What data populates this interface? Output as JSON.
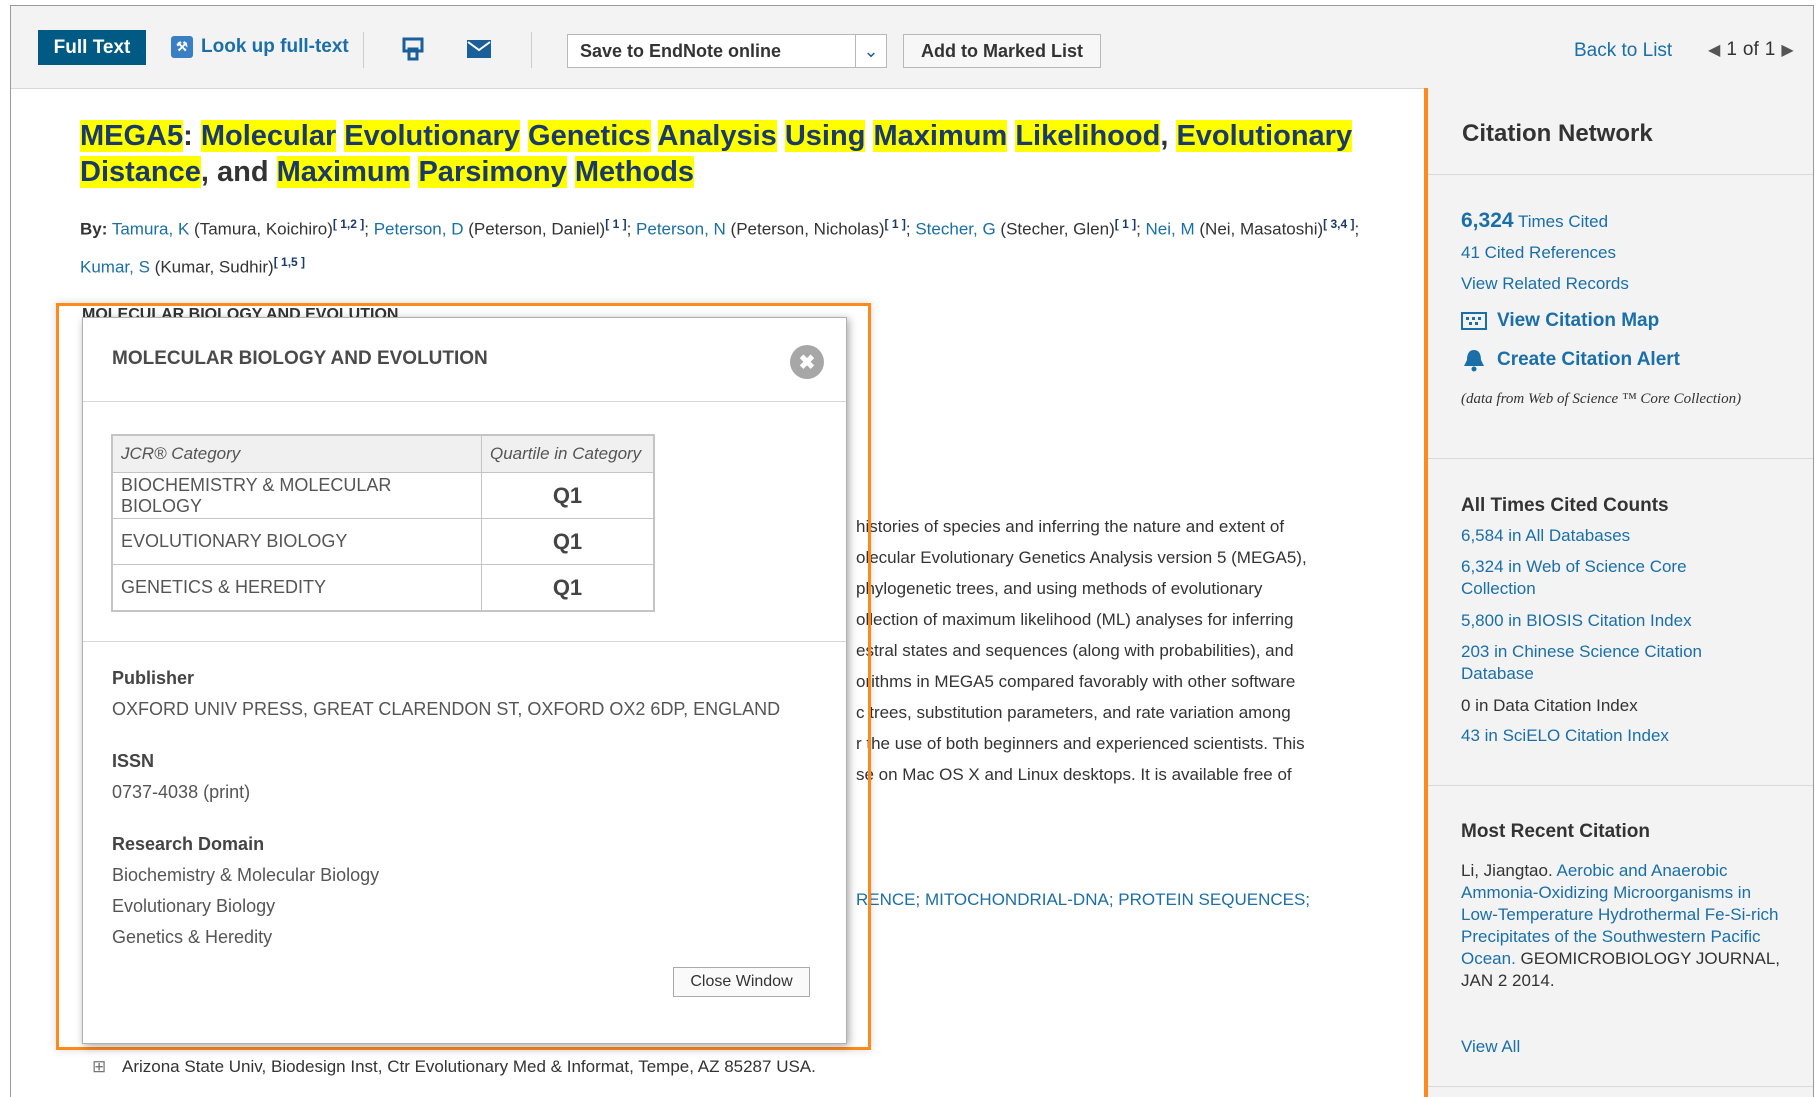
{
  "toolbar": {
    "full_text": "Full Text",
    "lookup": "Look up full-text",
    "endnote": "Save to EndNote online",
    "marked_list": "Add to Marked List",
    "back_to_list": "Back to List",
    "page_current": "1",
    "page_of": "of",
    "page_total": "1"
  },
  "article": {
    "title_parts": [
      "MEGA5",
      "Molecular",
      "Evolutionary",
      "Genetics",
      "Analysis",
      "Using",
      "Maximum",
      "Likelihood",
      "Evolutionary",
      "Distance",
      "and",
      "Maximum",
      "Parsimony",
      "Methods"
    ],
    "by_label": "By:",
    "authors": [
      {
        "link": "Tamura, K",
        "full": "(Tamura, Koichiro)",
        "aff": "[ 1,2 ]"
      },
      {
        "link": "Peterson, D",
        "full": "(Peterson, Daniel)",
        "aff": "[ 1 ]"
      },
      {
        "link": "Peterson, N",
        "full": "(Peterson, Nicholas)",
        "aff": "[ 1 ]"
      },
      {
        "link": "Stecher, G",
        "full": "(Stecher, Glen)",
        "aff": "[ 1 ]"
      },
      {
        "link": "Nei, M",
        "full": "(Nei, Masatoshi)",
        "aff": "[ 3,4 ]"
      },
      {
        "link": "Kumar, S",
        "full": "(Kumar, Sudhir)",
        "aff": "[ 1,5 ]"
      }
    ],
    "journal_behind": "MOLECULAR BIOLOGY AND EVOLUTION",
    "abstract_lines": [
      "histories of species and inferring the nature and extent of",
      "olecular Evolutionary Genetics Analysis version 5 (MEGA5),",
      "phylogenetic trees, and using methods of evolutionary",
      "ollection of maximum likelihood (ML) analyses for inferring",
      "estral states and sequences (along with probabilities), and",
      "orithms in MEGA5 compared favorably with other software",
      "c trees, substitution parameters, and rate variation among",
      "r the use of both beginners and experienced scientists. This",
      "se on Mac OS X and Linux desktops. It is available free of"
    ],
    "keywords_tail": "RENCE; MITOCHONDRIAL-DNA; PROTEIN SEQUENCES;",
    "address": "Arizona State Univ, Biodesign Inst, Ctr Evolutionary Med & Informat, Tempe, AZ 85287 USA."
  },
  "sidebar": {
    "title": "Citation Network",
    "times_cited_count": "6,324",
    "times_cited_label": "Times Cited",
    "cited_refs": "41 Cited References",
    "related": "View Related Records",
    "citation_map": "View Citation Map",
    "citation_alert": "Create Citation Alert",
    "note": "(data from Web of Science ™ Core Collection)",
    "counts_title": "All Times Cited Counts",
    "counts": [
      {
        "text": "6,584 in All Databases",
        "link": true
      },
      {
        "text": "6,324 in Web of Science Core Collection",
        "link": true
      },
      {
        "text": "5,800 in BIOSIS Citation Index",
        "link": true
      },
      {
        "text": "203 in Chinese Science Citation Database",
        "link": true
      },
      {
        "text": "0 in Data Citation Index",
        "link": false
      },
      {
        "text": "43 in SciELO Citation Index",
        "link": true
      }
    ],
    "recent_title": "Most Recent Citation",
    "recent_author": "Li, Jiangtao.",
    "recent_link": "Aerobic and Anaerobic Ammonia-Oxidizing Microorganisms in Low-Temperature Hydrothermal Fe-Si-rich Precipitates of the Southwestern Pacific Ocean.",
    "recent_source": "GEOMICROBIOLOGY JOURNAL, JAN 2 2014.",
    "view_all": "View All"
  },
  "popup": {
    "title": "MOLECULAR BIOLOGY AND EVOLUTION",
    "col_category": "JCR® Category",
    "col_quartile": "Quartile in Category",
    "rows": [
      {
        "category": "BIOCHEMISTRY & MOLECULAR BIOLOGY",
        "quartile": "Q1"
      },
      {
        "category": "EVOLUTIONARY BIOLOGY",
        "quartile": "Q1"
      },
      {
        "category": "GENETICS & HEREDITY",
        "quartile": "Q1"
      }
    ],
    "publisher_label": "Publisher",
    "publisher": "OXFORD UNIV PRESS, GREAT CLARENDON ST, OXFORD OX2 6DP, ENGLAND",
    "issn_label": "ISSN",
    "issn": "0737-4038 (print)",
    "domain_label": "Research Domain",
    "domains": [
      "Biochemistry & Molecular Biology",
      "Evolutionary Biology",
      "Genetics & Heredity"
    ],
    "close": "Close Window"
  },
  "colors": {
    "accent": "#ff8a1c",
    "link": "#1a6fa8",
    "highlight": "#ffff00",
    "primary_button": "#005a84"
  }
}
